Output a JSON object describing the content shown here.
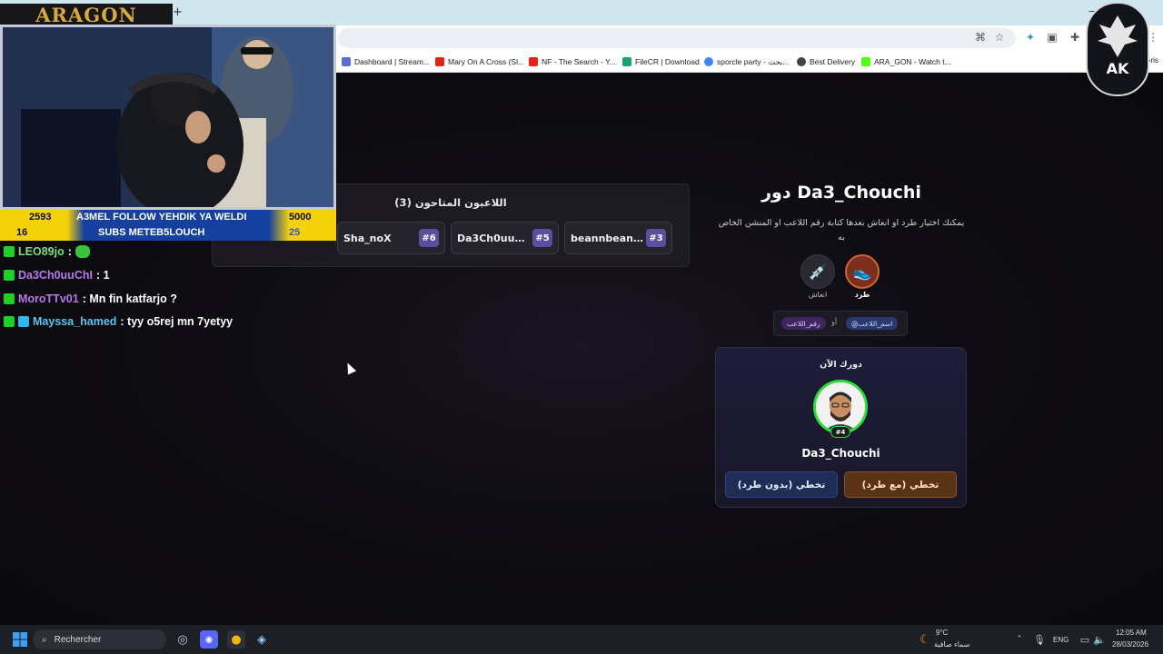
{
  "browser": {
    "bookmarks": [
      {
        "label": "Dashboard | Stream...",
        "icon": "streamlabs-icon",
        "color": "#5b6bd6"
      },
      {
        "label": "Mary On A Cross (Sl...",
        "icon": "youtube-icon",
        "color": "#e62117"
      },
      {
        "label": "NF - The Search - Y...",
        "icon": "youtube-icon",
        "color": "#e62117"
      },
      {
        "label": "FileCR | Download",
        "icon": "filecr-icon",
        "color": "#1aa36e"
      },
      {
        "label": "sporcle party - بحث...",
        "icon": "google-icon",
        "color": "#4285f4"
      },
      {
        "label": "Best Delivery",
        "icon": "delivery-icon",
        "color": "#444444"
      },
      {
        "label": "ARA_GON - Watch t...",
        "icon": "kick-icon",
        "color": "#53fc18"
      }
    ],
    "overflow": "»ris"
  },
  "overlay": {
    "brand": "ARAGON",
    "ticker": {
      "current_followers": "2593",
      "follow_message": "A3MEL FOLLOW YEHDIK YA WELDI",
      "follow_goal": "5000",
      "current_subs": "16",
      "subs_message": "SUBS METEB5LOUCH",
      "subs_goal": "25"
    },
    "chat": [
      {
        "user": "LEO89jo",
        "message": "",
        "color": "user-green",
        "emote": true
      },
      {
        "user": "Da3Ch0uuChI",
        "message": ": 1",
        "color": "user-purple",
        "emote": false
      },
      {
        "user": "MoroTTv01",
        "message": ": Mn fin katfarjo ?",
        "color": "user-purple",
        "emote": false
      },
      {
        "user": "Mayssa_hamed",
        "message": ": tyy o5rej mn 7yetyy",
        "color": "user-blue",
        "emote": false
      }
    ]
  },
  "game": {
    "players_title": "اللاعبون المتاحون (3)",
    "players": [
      {
        "name": "Sha_noX",
        "number": "#6"
      },
      {
        "name": "Da3Ch0uuCh...",
        "number": "#5"
      },
      {
        "name": "beannbeann...",
        "number": "#3"
      }
    ],
    "turn_title": "دور Da3_Chouchi",
    "instructions": "يمكنك اختيار طرد او انعاش بعدها كتابة رقم اللاعب او المنشن الخاص به",
    "actions": {
      "kick": "طرد",
      "revive": "انعاش"
    },
    "syntax": {
      "name": "@اسم_اللاعب",
      "or": "أو",
      "number": "رقم_اللاعب"
    },
    "current": {
      "label": "دورك الآن",
      "number": "#4",
      "name": "Da3_Chouchi",
      "skip_no_kick": "تخطي (بدون طرد)",
      "skip_kick": "تخطي (مع طرد)"
    }
  },
  "taskbar": {
    "search_placeholder": "Rechercher",
    "weather_temp": "9°C",
    "weather_desc": "سماء صافية",
    "language": "ENG",
    "time": "12:05 AM",
    "date": "28/03/2026"
  }
}
